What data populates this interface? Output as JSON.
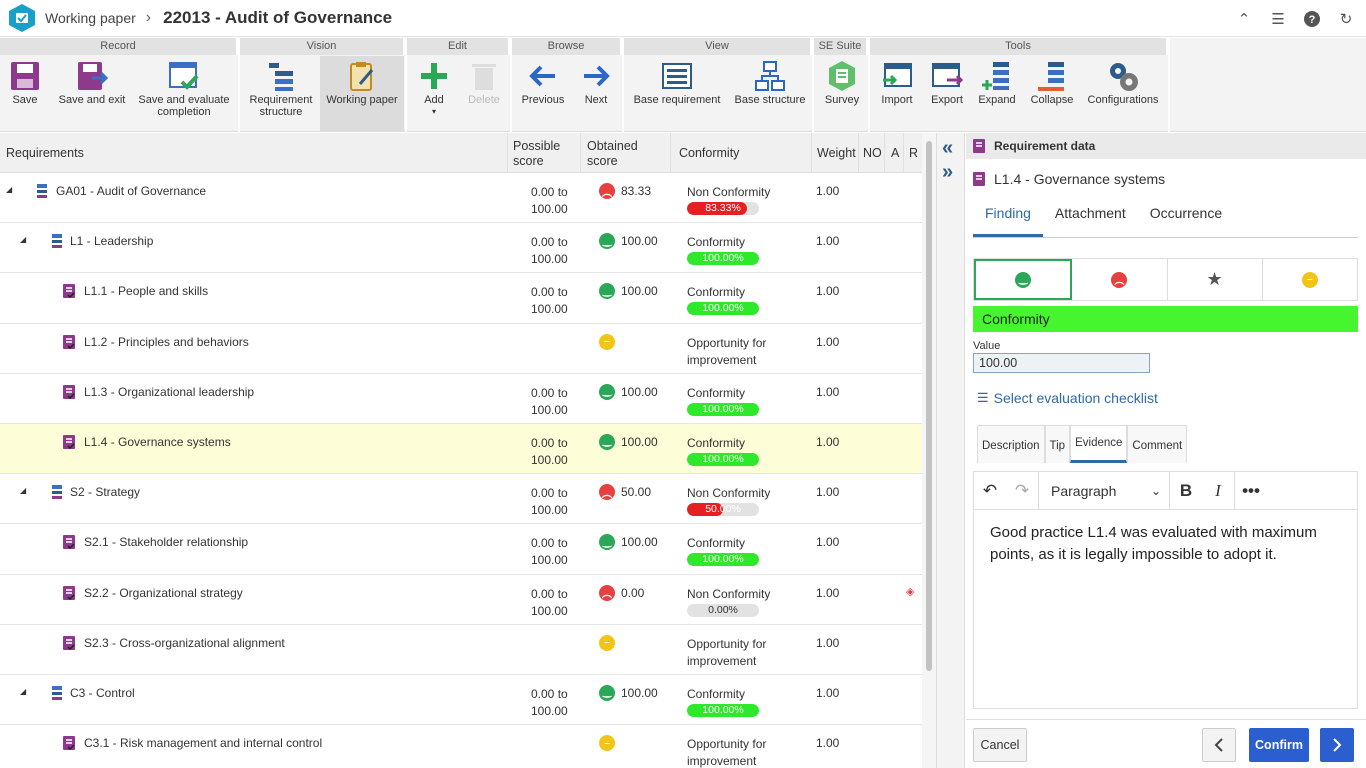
{
  "titlebar": {
    "app": "Working paper",
    "title": "22013 - Audit of Governance"
  },
  "ribbon": {
    "groups": {
      "record": "Record",
      "vision": "Vision",
      "edit": "Edit",
      "browse": "Browse",
      "view": "View",
      "se_suite": "SE Suite",
      "tools": "Tools"
    },
    "buttons": {
      "save": "Save",
      "save_exit": "Save and exit",
      "save_eval_1": "Save and evaluate",
      "save_eval_2": "completion",
      "req_struct_1": "Requirement",
      "req_struct_2": "structure",
      "working_paper": "Working paper",
      "add": "Add",
      "delete": "Delete",
      "previous": "Previous",
      "next": "Next",
      "base_req": "Base requirement",
      "base_struct": "Base structure",
      "survey": "Survey",
      "import": "Import",
      "export": "Export",
      "expand": "Expand",
      "collapse": "Collapse",
      "configurations": "Configurations"
    }
  },
  "grid": {
    "headers": {
      "requirements": "Requirements",
      "possible_1": "Possible",
      "possible_2": "score",
      "obtained_1": "Obtained",
      "obtained_2": "score",
      "conformity": "Conformity",
      "weight": "Weight",
      "no": "NO",
      "a": "A",
      "r": "R"
    },
    "rows": [
      {
        "name": "GA01 - Audit of Governance",
        "score_from": "0.00 to",
        "score_to": "100.00",
        "face": "red",
        "obtained": "83.33",
        "conf": "Non Conformity",
        "conf2": "",
        "bar": 83.33,
        "bar_label": "83.33%",
        "bar_color": "#e62020",
        "weight": "1.00"
      },
      {
        "name": "L1 - Leadership",
        "score_from": "0.00 to",
        "score_to": "100.00",
        "face": "green",
        "obtained": "100.00",
        "conf": "Conformity",
        "conf2": "",
        "bar": 100,
        "bar_label": "100.00%",
        "bar_color": "#2ee82a",
        "weight": "1.00"
      },
      {
        "name": "L1.1 - People and skills",
        "score_from": "0.00 to",
        "score_to": "100.00",
        "face": "green",
        "obtained": "100.00",
        "conf": "Conformity",
        "conf2": "",
        "bar": 100,
        "bar_label": "100.00%",
        "bar_color": "#2ee82a",
        "weight": "1.00"
      },
      {
        "name": "L1.2 - Principles and behaviors",
        "score_from": "",
        "score_to": "",
        "face": "yellow",
        "obtained": "",
        "conf": "Opportunity for",
        "conf2": "improvement",
        "bar": null,
        "bar_label": "",
        "bar_color": "",
        "weight": "1.00"
      },
      {
        "name": "L1.3 - Organizational leadership",
        "score_from": "0.00 to",
        "score_to": "100.00",
        "face": "green",
        "obtained": "100.00",
        "conf": "Conformity",
        "conf2": "",
        "bar": 100,
        "bar_label": "100.00%",
        "bar_color": "#2ee82a",
        "weight": "1.00"
      },
      {
        "name": "L1.4 - Governance systems",
        "score_from": "0.00 to",
        "score_to": "100.00",
        "face": "green",
        "obtained": "100.00",
        "conf": "Conformity",
        "conf2": "",
        "bar": 100,
        "bar_label": "100.00%",
        "bar_color": "#2ee82a",
        "weight": "1.00"
      },
      {
        "name": "S2 - Strategy",
        "score_from": "0.00 to",
        "score_to": "100.00",
        "face": "red",
        "obtained": "50.00",
        "conf": "Non Conformity",
        "conf2": "",
        "bar": 50,
        "bar_label": "50.00%",
        "bar_color": "#e62020",
        "weight": "1.00"
      },
      {
        "name": "S2.1 - Stakeholder relationship",
        "score_from": "0.00 to",
        "score_to": "100.00",
        "face": "green",
        "obtained": "100.00",
        "conf": "Conformity",
        "conf2": "",
        "bar": 100,
        "bar_label": "100.00%",
        "bar_color": "#2ee82a",
        "weight": "1.00"
      },
      {
        "name": "S2.2 - Organizational strategy",
        "score_from": "0.00 to",
        "score_to": "100.00",
        "face": "red",
        "obtained": "0.00",
        "conf": "Non Conformity",
        "conf2": "",
        "bar": 0,
        "bar_label": "0.00%",
        "bar_color": "#e62020",
        "weight": "1.00"
      },
      {
        "name": "S2.3 - Cross-organizational alignment",
        "score_from": "",
        "score_to": "",
        "face": "yellow",
        "obtained": "",
        "conf": "Opportunity for",
        "conf2": "improvement",
        "bar": null,
        "bar_label": "",
        "bar_color": "",
        "weight": "1.00"
      },
      {
        "name": "C3 - Control",
        "score_from": "0.00 to",
        "score_to": "100.00",
        "face": "green",
        "obtained": "100.00",
        "conf": "Conformity",
        "conf2": "",
        "bar": 100,
        "bar_label": "100.00%",
        "bar_color": "#2ee82a",
        "weight": "1.00"
      },
      {
        "name": "C3.1 - Risk management and internal control",
        "score_from": "",
        "score_to": "",
        "face": "yellow",
        "obtained": "",
        "conf": "Opportunity for",
        "conf2": "improvement",
        "bar": null,
        "bar_label": "",
        "bar_color": "",
        "weight": "1.00"
      }
    ]
  },
  "panel": {
    "header": "Requirement data",
    "requirement": "L1.4 - Governance systems",
    "tabs": [
      "Finding",
      "Attachment",
      "Occurrence"
    ],
    "finding": "Conformity",
    "value_label": "Value",
    "value": "100.00",
    "checklist_link": "Select evaluation checklist",
    "sub_tabs": [
      "Description",
      "Tip",
      "Evidence",
      "Comment"
    ],
    "paragraph_style": "Paragraph",
    "evidence_text": "Good practice L1.4 was evaluated with maximum points, as it is legally impossible to adopt it.",
    "cancel": "Cancel",
    "confirm": "Confirm"
  }
}
